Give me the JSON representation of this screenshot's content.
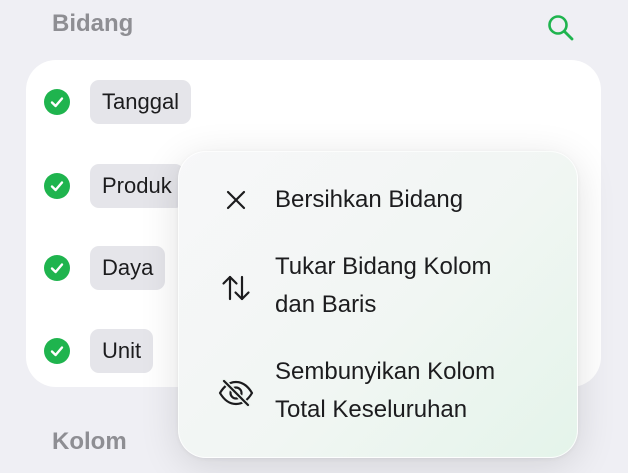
{
  "sections": {
    "fields_header": "Bidang",
    "columns_header": "Kolom"
  },
  "fields": [
    {
      "label": "Tanggal"
    },
    {
      "label": "Produk"
    },
    {
      "label": "Daya"
    },
    {
      "label": "Unit"
    }
  ],
  "context_menu": {
    "items": [
      {
        "icon": "close-icon",
        "lines": [
          "Bersihkan Bidang"
        ]
      },
      {
        "icon": "swap-arrows-icon",
        "lines": [
          "Tukar Bidang Kolom",
          "dan Baris"
        ]
      },
      {
        "icon": "eye-slash-icon",
        "lines": [
          "Sembunyikan Kolom",
          "Total Keseluruhan"
        ]
      }
    ]
  },
  "colors": {
    "accent": "#1fb44e",
    "header_text": "#8e8e93",
    "background": "#efeff4"
  }
}
